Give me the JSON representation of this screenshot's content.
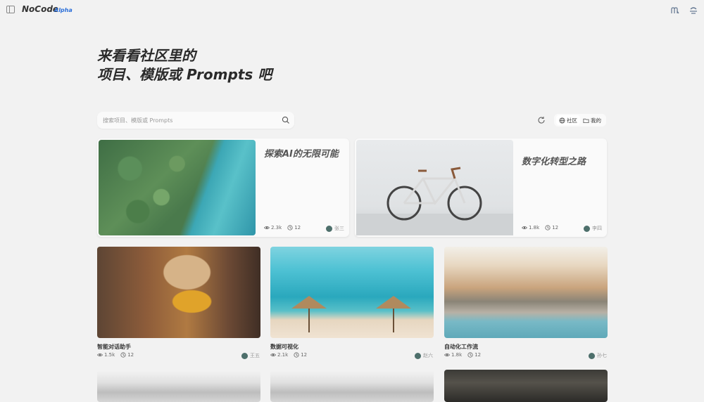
{
  "header": {
    "brand": "NoCode",
    "badge": "Alpha"
  },
  "hero": {
    "line1": "来看看社区里的",
    "line2": "项目、模版或 Prompts 吧"
  },
  "search": {
    "placeholder": "搜索项目、模版或 Prompts"
  },
  "filters": {
    "community": "社区",
    "mine": "我的"
  },
  "featured": [
    {
      "title": "探索AI的无限可能",
      "views": "2.3k",
      "history": "12",
      "author": "张三"
    },
    {
      "title": "数字化转型之路",
      "views": "1.8k",
      "history": "12",
      "author": "李四"
    }
  ],
  "cards": [
    {
      "title": "智能对话助手",
      "views": "1.5k",
      "history": "12",
      "author": "王五"
    },
    {
      "title": "数据可视化",
      "views": "2.1k",
      "history": "12",
      "author": "赵六"
    },
    {
      "title": "自动化工作流",
      "views": "1.8k",
      "history": "12",
      "author": "孙七"
    }
  ]
}
